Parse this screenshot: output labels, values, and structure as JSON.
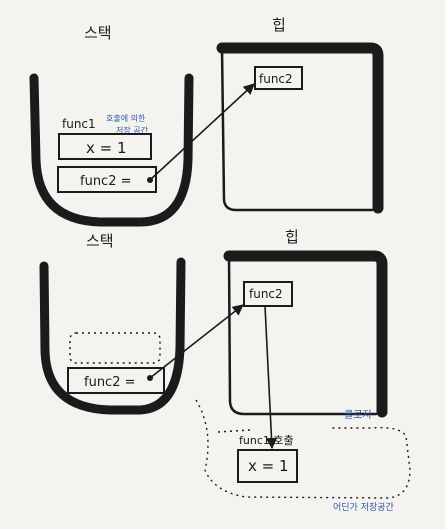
{
  "top": {
    "stack_label": "스택",
    "heap_label": "힙",
    "func1_annotation": "func1",
    "func1_note_line1": "호출에 의한",
    "func1_note_line2": "저장 공간",
    "x_var": "x = 1",
    "func2_var": "func2 =",
    "heap_func2": "func2"
  },
  "bottom": {
    "stack_label": "스택",
    "heap_label": "힙",
    "func2_var": "func2 =",
    "heap_func2": "func2",
    "closure_label": "클로저",
    "func1_label": "func1 호출",
    "x_var": "x = 1",
    "storage_label": "어딘가 저장공간"
  },
  "colors": {
    "ink": "#1b1b1b",
    "blue": "#2b57a8",
    "paper": "#f4f3ef"
  }
}
